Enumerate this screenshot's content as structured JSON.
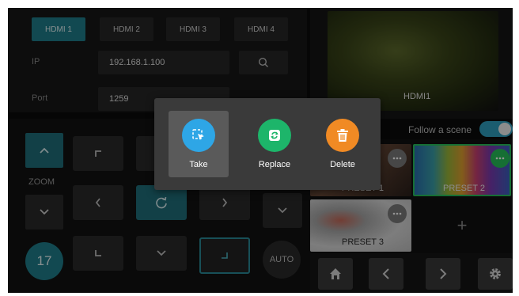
{
  "inputs": {
    "tabs": [
      "HDMI 1",
      "HDMI 2",
      "HDMI 3",
      "HDMI 4"
    ],
    "selected_tab": 0,
    "ip_label": "IP",
    "ip_value": "192.168.1.100",
    "port_label": "Port",
    "port_value": "1259"
  },
  "preview": {
    "caption": "HDMI1"
  },
  "follow": {
    "label": "Follow a scene",
    "enabled": true
  },
  "ptz": {
    "zoom_label": "ZOOM",
    "speed_value": "17",
    "auto_label": "AUTO"
  },
  "presets": {
    "items": [
      "PRESET 1",
      "PRESET 2",
      "PRESET 3"
    ],
    "add_symbol": "+"
  },
  "popup": {
    "actions": [
      {
        "label": "Take",
        "color": "#2ea6e6",
        "icon": "cursor-select-icon"
      },
      {
        "label": "Replace",
        "color": "#1db56a",
        "icon": "replace-icon"
      },
      {
        "label": "Delete",
        "color": "#f08a24",
        "icon": "trash-icon"
      }
    ]
  },
  "colors": {
    "accent": "#1f7f8c",
    "toggle": "#2f9fbf",
    "preset_selected": "#27c05a"
  }
}
